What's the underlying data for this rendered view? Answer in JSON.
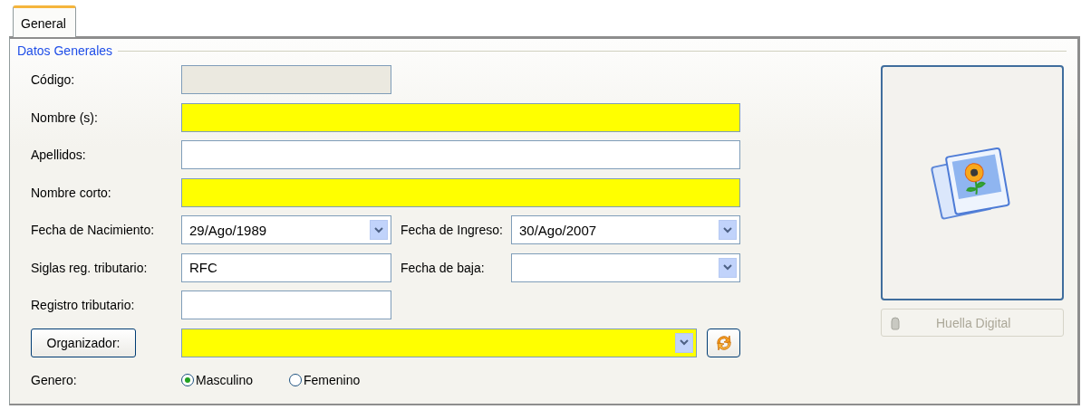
{
  "tabs": [
    {
      "label": "General",
      "selected": true
    }
  ],
  "group": {
    "title": "Datos Generales"
  },
  "rows": [
    {
      "kind": "short_field",
      "label": "Código:",
      "disabled": true,
      "required": false
    },
    {
      "kind": "field",
      "label": "Nombre (s):",
      "disabled": false,
      "required": true
    },
    {
      "kind": "field",
      "label": "Apellidos:",
      "disabled": false,
      "required": false
    },
    {
      "kind": "field",
      "label": "Nombre corto:",
      "disabled": false,
      "required": true
    },
    {
      "kind": "pair",
      "left": {
        "kind": "date",
        "label": "Fecha de Nacimiento:",
        "value": "29/Ago/1989"
      },
      "right": {
        "kind": "date",
        "label": "Fecha de Ingreso:",
        "value": "30/Ago/2007"
      }
    },
    {
      "kind": "pair",
      "left": {
        "kind": "text",
        "label": "Siglas reg. tributario:",
        "value": "RFC"
      },
      "right": {
        "kind": "date",
        "label": "Fecha de baja:"
      }
    },
    {
      "kind": "short_field",
      "label": "Registro tributario:",
      "disabled": false,
      "required": false
    },
    {
      "kind": "organizer",
      "button": "Organizador:",
      "required": true
    },
    {
      "kind": "radio",
      "label": "Genero:",
      "options": [
        {
          "label": "Masculino",
          "selected": true
        },
        {
          "label": "Femenino",
          "selected": false
        }
      ]
    }
  ],
  "photo": {
    "button": "Huella Digital",
    "disabled": true
  }
}
